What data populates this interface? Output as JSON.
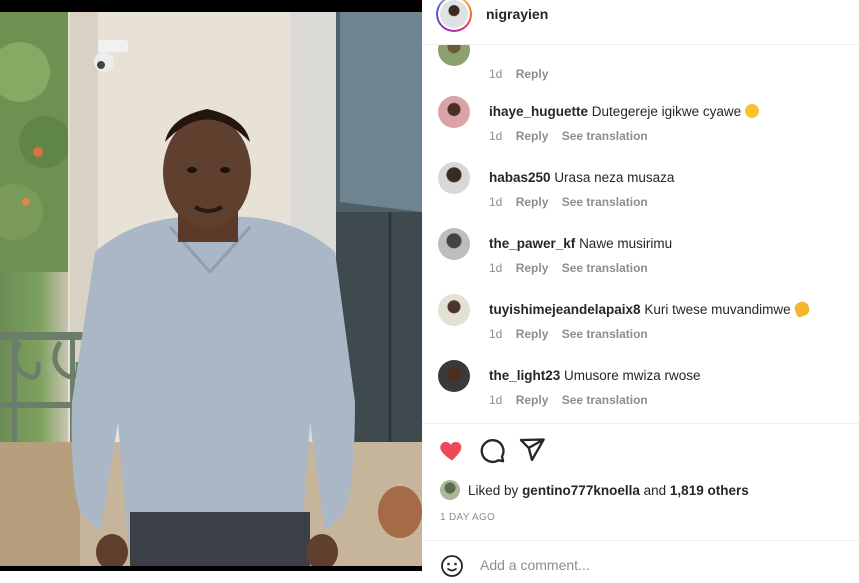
{
  "post": {
    "username": "nigrayien"
  },
  "comments": [
    {
      "username": "",
      "text": "",
      "time": "1d",
      "reply": "Reply",
      "translate": ""
    },
    {
      "username": "ihaye_huguette",
      "text": "Dutegereje igikwe cyawe",
      "emoji": "laughing-emoji-icon",
      "time": "1d",
      "reply": "Reply",
      "translate": "See translation"
    },
    {
      "username": "habas250",
      "text": "Urasa neza musaza",
      "time": "1d",
      "reply": "Reply",
      "translate": "See translation"
    },
    {
      "username": "the_pawer_kf",
      "text": "Nawe musirimu",
      "time": "1d",
      "reply": "Reply",
      "translate": "See translation"
    },
    {
      "username": "tuyishimejeandelapaix8",
      "text": "Kuri twese muvandimwe",
      "emoji": "clapping-hands-emoji-icon",
      "time": "1d",
      "reply": "Reply",
      "translate": "See translation"
    },
    {
      "username": "the_light23",
      "text": "Umusore mwiza rwose",
      "time": "1d",
      "reply": "Reply",
      "translate": "See translation"
    }
  ],
  "likes": {
    "prefix": "Liked by",
    "user": "gentino777knoella",
    "and": "and",
    "others": "1,819 others",
    "liked": true,
    "like_color": "#ed4956"
  },
  "timestamp": "1 DAY AGO",
  "add_comment": {
    "placeholder": "Add a comment..."
  },
  "icons": {
    "like": "heart-icon",
    "comment": "comment-icon",
    "share": "share-icon",
    "emoji": "emoji-icon"
  }
}
